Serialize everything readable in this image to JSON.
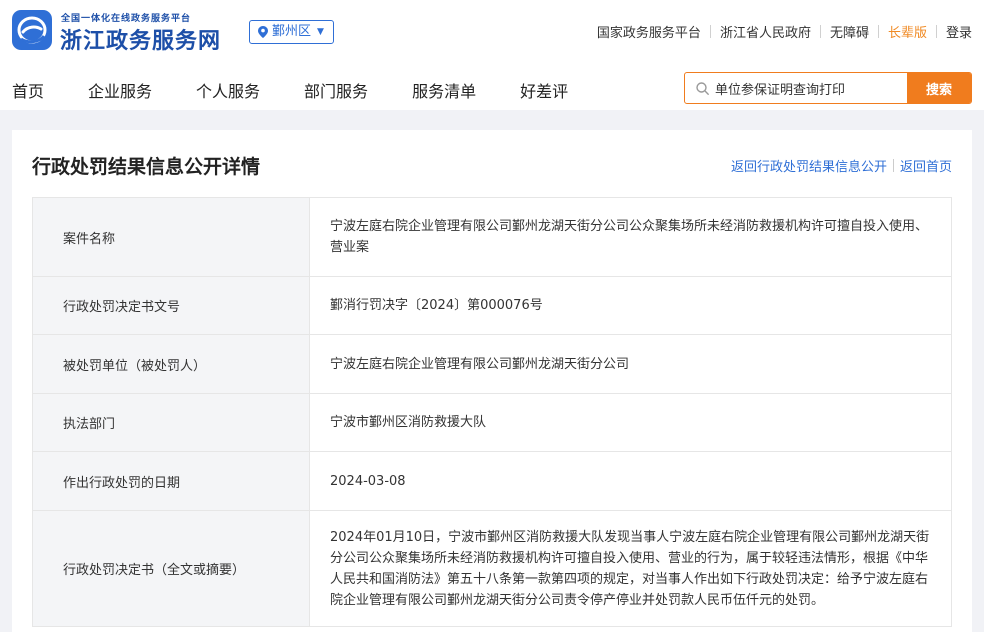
{
  "header": {
    "tagline": "全国一体化在线政务服务平台",
    "site_name": "浙江政务服务网",
    "region": "鄞州区",
    "links": [
      "国家政务服务平台",
      "浙江省人民政府",
      "无障碍",
      "长辈版",
      "登录"
    ]
  },
  "nav": [
    "首页",
    "企业服务",
    "个人服务",
    "部门服务",
    "服务清单",
    "好差评"
  ],
  "search": {
    "value": "单位参保证明查询打印",
    "button": "搜索"
  },
  "page": {
    "title": "行政处罚结果信息公开详情",
    "back_list": "返回行政处罚结果信息公开",
    "back_home": "返回首页"
  },
  "detail": [
    {
      "key": "案件名称",
      "value": "宁波左庭右院企业管理有限公司鄞州龙湖天街分公司公众聚集场所未经消防救援机构许可擅自投入使用、营业案"
    },
    {
      "key": "行政处罚决定书文号",
      "value": "鄞消行罚决字〔2024〕第000076号"
    },
    {
      "key": "被处罚单位（被处罚人）",
      "value": "宁波左庭右院企业管理有限公司鄞州龙湖天街分公司"
    },
    {
      "key": "执法部门",
      "value": "宁波市鄞州区消防救援大队"
    },
    {
      "key": "作出行政处罚的日期",
      "value": "2024-03-08"
    },
    {
      "key": "行政处罚决定书（全文或摘要）",
      "value": "2024年01月10日，宁波市鄞州区消防救援大队发现当事人宁波左庭右院企业管理有限公司鄞州龙湖天街分公司公众聚集场所未经消防救援机构许可擅自投入使用、营业的行为，属于较轻违法情形，根据《中华人民共和国消防法》第五十八条第一款第四项的规定，对当事人作出如下行政处罚决定：给予宁波左庭右院企业管理有限公司鄞州龙湖天街分公司责令停产停业并处罚款人民币伍仟元的处罚。"
    }
  ],
  "colors": {
    "brand": "#1d4fa8",
    "accent": "#f07c1e",
    "link": "#2f6fd6"
  }
}
